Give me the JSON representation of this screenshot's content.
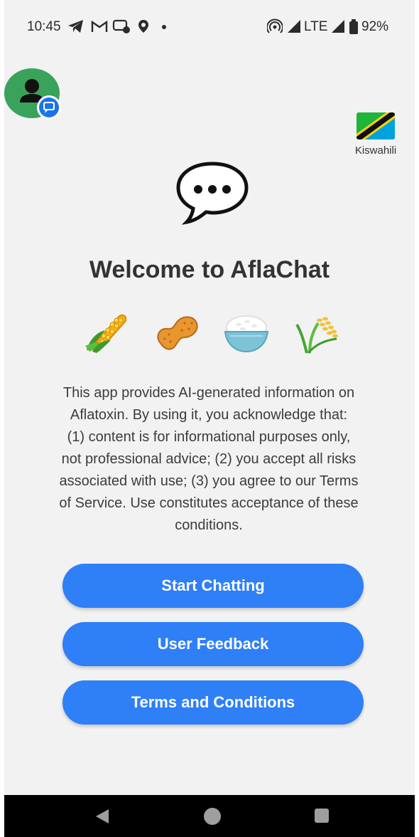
{
  "status_bar": {
    "time": "10:45",
    "network": "LTE",
    "battery": "92%",
    "icons": [
      "telegram-icon",
      "gmail-icon",
      "chat-icon",
      "location-icon",
      "dot-icon",
      "hotspot-icon",
      "signal-icon",
      "battery-icon"
    ]
  },
  "header": {
    "avatar_icon": "person-icon",
    "badge_icon": "message-badge-icon",
    "language_label": "Kiswahili",
    "flag_icon": "tanzania-flag-icon"
  },
  "main": {
    "logo_icon": "speech-bubble-icon",
    "title": "Welcome to AflaChat",
    "crop_icons": [
      "corn-icon",
      "peanut-icon",
      "rice-bowl-icon",
      "rice-plant-icon"
    ],
    "disclaimer_lines": [
      "This app provides AI-generated information on",
      "Aflatoxin. By using it, you acknowledge that:",
      "(1) content is for informational purposes only,",
      "not professional advice; (2) you accept all risks",
      "associated with use; (3) you agree to our Terms",
      "of Service. Use constitutes acceptance of these",
      "conditions."
    ]
  },
  "buttons": {
    "start_chatting": "Start Chatting",
    "user_feedback": "User Feedback",
    "terms_and_conditions": "Terms and Conditions"
  },
  "nav_bar": {
    "back_icon": "back-triangle-icon",
    "home_icon": "home-circle-icon",
    "recents_icon": "recents-square-icon"
  },
  "colors": {
    "background": "#f2f2f2",
    "button": "#2f7ff7",
    "avatar": "#3aa35b",
    "title": "#333333",
    "nav_bar": "#000000"
  }
}
